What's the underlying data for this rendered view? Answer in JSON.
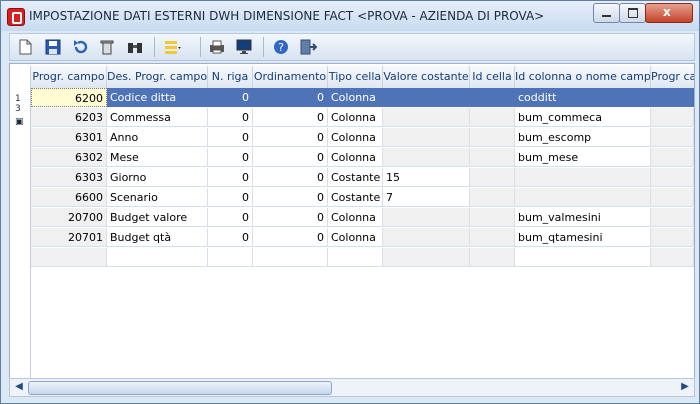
{
  "window": {
    "title": "IMPOSTAZIONE DATI ESTERNI DWH DIMENSIONE FACT <PROVA - AZIENDA DI PROVA>",
    "close_glyph": "x"
  },
  "toolbar": {
    "icons": [
      "new-icon",
      "save-icon",
      "undo-icon",
      "delete-icon",
      "find-icon",
      "layout-icon",
      "print-icon",
      "screen-icon",
      "help-icon",
      "exit-icon"
    ]
  },
  "grid": {
    "row_marker_top": "1",
    "row_marker_mid": "3",
    "columns": [
      "Progr. campo",
      "Des. Progr. campo",
      "N. riga",
      "Ordinamento",
      "Tipo cella",
      "Valore costante",
      "Id cella",
      "Id colonna o nome campo",
      "Progr ca"
    ],
    "rows": [
      {
        "progr": "6200",
        "des": "Codice ditta",
        "nriga": "0",
        "ord": "0",
        "tipo": "Colonna",
        "valore": "",
        "idcella": "",
        "idcol": "codditt"
      },
      {
        "progr": "6203",
        "des": "Commessa",
        "nriga": "0",
        "ord": "0",
        "tipo": "Colonna",
        "valore": "",
        "idcella": "",
        "idcol": "bum_commeca"
      },
      {
        "progr": "6301",
        "des": "Anno",
        "nriga": "0",
        "ord": "0",
        "tipo": "Colonna",
        "valore": "",
        "idcella": "",
        "idcol": "bum_escomp"
      },
      {
        "progr": "6302",
        "des": "Mese",
        "nriga": "0",
        "ord": "0",
        "tipo": "Colonna",
        "valore": "",
        "idcella": "",
        "idcol": "bum_mese"
      },
      {
        "progr": "6303",
        "des": "Giorno",
        "nriga": "0",
        "ord": "0",
        "tipo": "Costante",
        "valore": "15",
        "idcella": "",
        "idcol": ""
      },
      {
        "progr": "6600",
        "des": "Scenario",
        "nriga": "0",
        "ord": "0",
        "tipo": "Costante",
        "valore": "7",
        "idcella": "",
        "idcol": ""
      },
      {
        "progr": "20700",
        "des": "Budget valore",
        "nriga": "0",
        "ord": "0",
        "tipo": "Colonna",
        "valore": "",
        "idcella": "",
        "idcol": "bum_valmesini"
      },
      {
        "progr": "20701",
        "des": "Budget qtà",
        "nriga": "0",
        "ord": "0",
        "tipo": "Colonna",
        "valore": "",
        "idcella": "",
        "idcol": "bum_qtamesini"
      }
    ]
  }
}
